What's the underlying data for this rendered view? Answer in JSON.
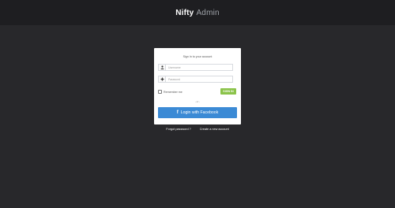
{
  "brand": {
    "name_bold": "Nifty",
    "name_light": "Admin"
  },
  "login": {
    "title": "Sign In to your account",
    "username_placeholder": "Username",
    "password_placeholder": "Password",
    "remember_label": "Remember me",
    "signin_label": "SIGN IN",
    "or_text": "- or -",
    "facebook_label": "Login with Facebook"
  },
  "links": {
    "forgot": "Forgot password ?",
    "create": "Create a new account"
  },
  "icons": {
    "user": "user-icon",
    "password": "key-icon",
    "facebook": "facebook-icon"
  },
  "colors": {
    "background": "#28282b",
    "topbar": "#1e1e21",
    "signin": "#8bc34a",
    "facebook": "#3b8ad5"
  }
}
